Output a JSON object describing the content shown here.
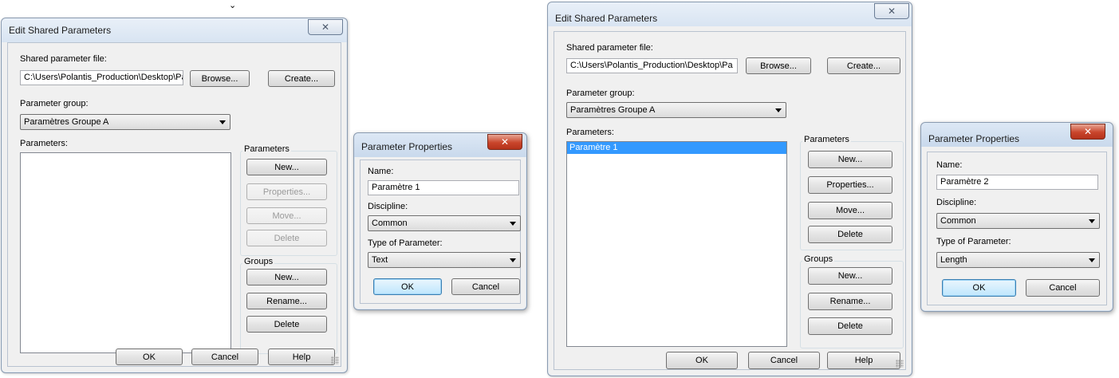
{
  "left": {
    "edit_dialog": {
      "title": "Edit Shared Parameters",
      "file_label": "Shared parameter file:",
      "file_value": "C:\\Users\\Polantis_Production\\Desktop\\Pa",
      "browse": "Browse...",
      "create": "Create...",
      "group_label": "Parameter group:",
      "group_value": "Paramètres Groupe A",
      "parameters_label": "Parameters:",
      "parameters_items": [],
      "params_box": {
        "label": "Parameters",
        "new": "New...",
        "properties": "Properties...",
        "move": "Move...",
        "delete": "Delete"
      },
      "groups_box": {
        "label": "Groups",
        "new": "New...",
        "rename": "Rename...",
        "delete": "Delete"
      },
      "ok": "OK",
      "cancel": "Cancel",
      "help": "Help"
    },
    "props_dialog": {
      "title": "Parameter Properties",
      "name_label": "Name:",
      "name_value": "Paramètre 1",
      "discipline_label": "Discipline:",
      "discipline_value": "Common",
      "type_label": "Type of Parameter:",
      "type_value": "Text",
      "ok": "OK",
      "cancel": "Cancel"
    }
  },
  "right": {
    "edit_dialog": {
      "title": "Edit Shared Parameters",
      "file_label": "Shared parameter file:",
      "file_value": "C:\\Users\\Polantis_Production\\Desktop\\Pa",
      "browse": "Browse...",
      "create": "Create...",
      "group_label": "Parameter group:",
      "group_value": "Paramètres Groupe A",
      "parameters_label": "Parameters:",
      "parameters_items": [
        "Paramètre 1"
      ],
      "params_box": {
        "label": "Parameters",
        "new": "New...",
        "properties": "Properties...",
        "move": "Move...",
        "delete": "Delete"
      },
      "groups_box": {
        "label": "Groups",
        "new": "New...",
        "rename": "Rename...",
        "delete": "Delete"
      },
      "ok": "OK",
      "cancel": "Cancel",
      "help": "Help"
    },
    "props_dialog": {
      "title": "Parameter Properties",
      "name_label": "Name:",
      "name_value": "Paramètre 2",
      "discipline_label": "Discipline:",
      "discipline_value": "Common",
      "type_label": "Type of Parameter:",
      "type_value": "Length",
      "ok": "OK",
      "cancel": "Cancel"
    }
  },
  "icons": {
    "close": "✕",
    "mouse_cursor": "⌄"
  },
  "colors": {
    "selection": "#3399ff",
    "close_red": "#c9452b",
    "default_button": "#bee6fd"
  }
}
